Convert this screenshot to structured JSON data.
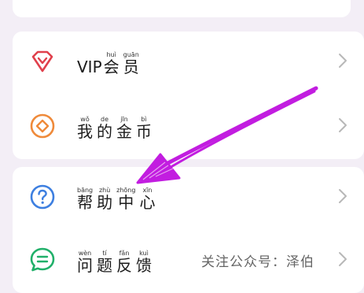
{
  "menu": {
    "vip": {
      "prefix": "VIP",
      "chars": [
        {
          "py": "huì",
          "hz": "会"
        },
        {
          "py": "guān",
          "hz": "员"
        }
      ]
    },
    "coins": {
      "chars": [
        {
          "py": "wǒ",
          "hz": "我"
        },
        {
          "py": "de",
          "hz": "的"
        },
        {
          "py": "jīn",
          "hz": "金"
        },
        {
          "py": "bì",
          "hz": "币"
        }
      ]
    },
    "help": {
      "chars": [
        {
          "py": "bāng",
          "hz": "帮"
        },
        {
          "py": "zhù",
          "hz": "助"
        },
        {
          "py": "zhōng",
          "hz": "中"
        },
        {
          "py": "xīn",
          "hz": "心"
        }
      ]
    },
    "feedback": {
      "chars": [
        {
          "py": "wèn",
          "hz": "问"
        },
        {
          "py": "tí",
          "hz": "题"
        },
        {
          "py": "fǎn",
          "hz": "反"
        },
        {
          "py": "kuì",
          "hz": "馈"
        }
      ]
    }
  },
  "watermark": "关注公众号：泽伯",
  "colors": {
    "vip_icon": "#e0404c",
    "coins_icon": "#ef8a3a",
    "help_icon": "#3d7fe0",
    "feedback_icon": "#21b06a",
    "arrow": "#c21de0",
    "chevron": "#b8b8b8"
  },
  "icons": {
    "vip": "diamond-icon",
    "coins": "coin-icon",
    "help": "question-circle-icon",
    "feedback": "chat-bubble-icon"
  }
}
